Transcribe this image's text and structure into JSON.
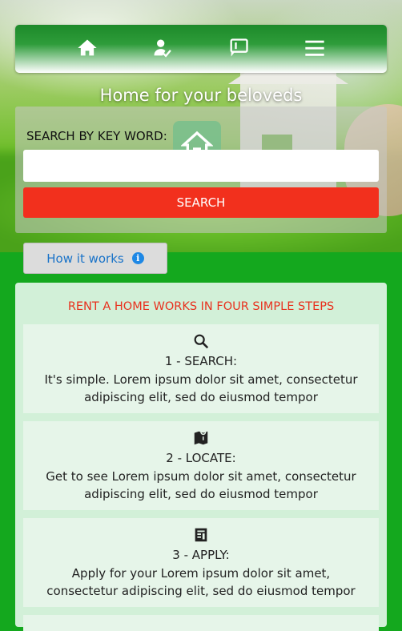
{
  "nav": {
    "items": [
      {
        "icon": "home-icon"
      },
      {
        "icon": "user-check-icon"
      },
      {
        "icon": "message-icon"
      },
      {
        "icon": "menu-icon"
      }
    ]
  },
  "hero": {
    "tagline": "Home for your beloveds"
  },
  "search": {
    "label": "SEARCH BY KEY WORD:",
    "placeholder": "",
    "value": "",
    "button_label": "SEARCH"
  },
  "how_it_works": {
    "label": "How it works",
    "icon": "info-icon"
  },
  "steps": {
    "title": "RENT A HOME WORKS IN FOUR SIMPLE STEPS",
    "items": [
      {
        "icon": "search-icon",
        "heading": "1 - SEARCH:",
        "text": "It's simple. Lorem ipsum dolor sit amet, consectetur adipiscing elit, sed do eiusmod tempor"
      },
      {
        "icon": "map-pin-icon",
        "heading": "2 - LOCATE:",
        "text": "Get to see Lorem ipsum dolor sit amet, consectetur adipiscing elit, sed do eiusmod tempor"
      },
      {
        "icon": "form-icon",
        "heading": "3 - APPLY:",
        "text": "Apply for your Lorem ipsum dolor sit amet, consectetur adipiscing elit, sed do eiusmod tempor"
      }
    ]
  },
  "colors": {
    "page_bg": "#14a81e",
    "accent_red": "#f2301d",
    "link_blue": "#1a73c8"
  }
}
